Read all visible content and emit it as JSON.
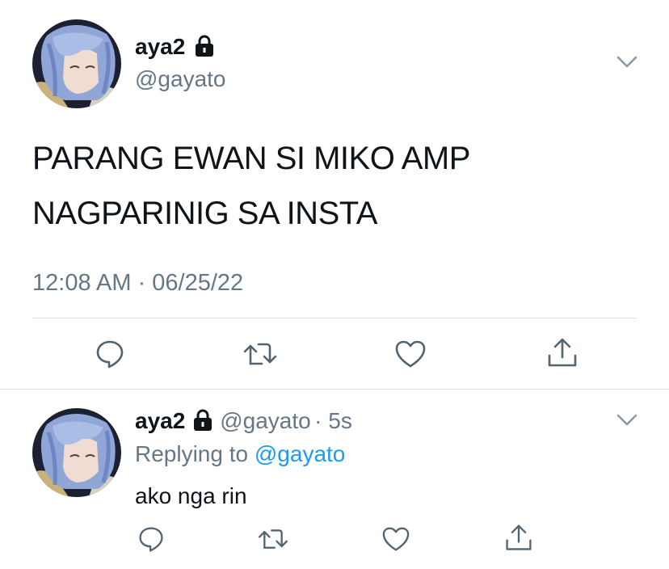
{
  "main_tweet": {
    "display_name": "aya2",
    "handle": "@gayato",
    "text_line1": "PARANG EWAN SI MIKO AMP",
    "text_line2": "NAGPARINIG SA INSTA",
    "timestamp": "12:08 AM · 06/25/22"
  },
  "reply_tweet": {
    "display_name": "aya2",
    "handle": "@gayato",
    "age": "· 5s",
    "replying_prefix": "Replying to",
    "replying_handle": "@gayato",
    "text": "ako nga rin"
  },
  "icons": [
    "lock-icon",
    "chevron-down-icon",
    "reply-icon",
    "retweet-icon",
    "like-icon",
    "share-icon"
  ],
  "colors": {
    "text": "#0f1419",
    "secondary": "#657786",
    "link": "#1d9bf0",
    "divider": "#dcdfe2"
  }
}
